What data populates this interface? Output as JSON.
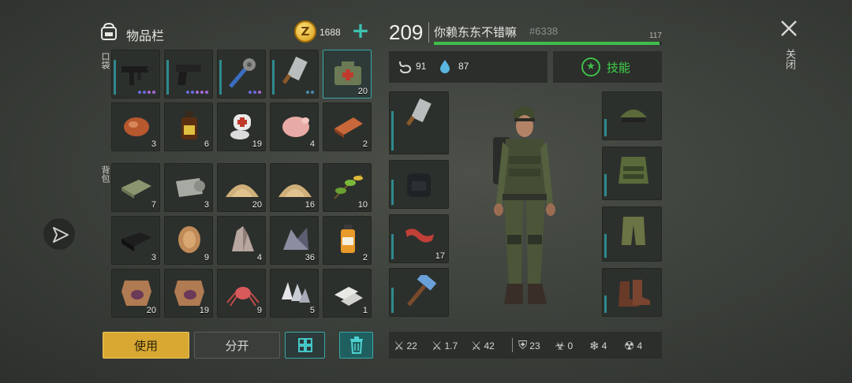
{
  "inventory": {
    "title": "物品栏",
    "coins": "1688",
    "pocket_label": "口袋",
    "backpack_label": "背包",
    "pocket_row1": [
      {
        "icon": "smg-icon",
        "qty": "",
        "dots": [
          "#6a6adf",
          "#6a6adf",
          "#a76ad5",
          "#a76ad5"
        ]
      },
      {
        "icon": "pistol-icon",
        "qty": "",
        "dots": [
          "#6a6adf",
          "#6a6adf",
          "#a76ad5",
          "#a76ad5",
          "#a76ad5"
        ]
      },
      {
        "icon": "spiked-club-icon",
        "qty": "",
        "dots": [
          "#6a6adf",
          "#6a6adf",
          "#a76ad5"
        ]
      },
      {
        "icon": "cleaver-icon",
        "qty": "",
        "dots": [
          "#4a8ab0",
          "#4a8ab0"
        ]
      },
      {
        "icon": "medkit-icon",
        "qty": "20",
        "dots": []
      }
    ],
    "pocket_row2": [
      {
        "icon": "meat-chunk-icon",
        "qty": "3"
      },
      {
        "icon": "bottle-icon",
        "qty": "6"
      },
      {
        "icon": "bandage-icon",
        "qty": "19"
      },
      {
        "icon": "raw-chicken-icon",
        "qty": "4"
      },
      {
        "icon": "copper-ingot-icon",
        "qty": "2"
      }
    ],
    "backpack_row1": [
      {
        "icon": "cloth-icon",
        "qty": "7"
      },
      {
        "icon": "fabric-roll-icon",
        "qty": "3"
      },
      {
        "icon": "sand-pile-icon",
        "qty": "20"
      },
      {
        "icon": "sand-pile-icon",
        "qty": "16"
      },
      {
        "icon": "plant-fiber-icon",
        "qty": "10"
      }
    ],
    "backpack_row2": [
      {
        "icon": "black-leather-icon",
        "qty": "3"
      },
      {
        "icon": "fur-icon",
        "qty": "9"
      },
      {
        "icon": "stone-crystal-icon",
        "qty": "4"
      },
      {
        "icon": "iron-crystal-icon",
        "qty": "36"
      },
      {
        "icon": "oil-bottle-icon",
        "qty": "2"
      }
    ],
    "backpack_row3": [
      {
        "icon": "hide-icon",
        "qty": "20"
      },
      {
        "icon": "hide-icon",
        "qty": "19"
      },
      {
        "icon": "spider-icon",
        "qty": "9"
      },
      {
        "icon": "quartz-icon",
        "qty": "5"
      },
      {
        "icon": "steel-bars-icon",
        "qty": "1"
      }
    ],
    "use_button": "使用",
    "split_button": "分开"
  },
  "character": {
    "level": "209",
    "name": "你赖东东不错嘛",
    "tag": "#6338",
    "xp_value": "117",
    "xp_fraction": 0.99,
    "hunger": "91",
    "thirst": "87",
    "skills_label": "技能",
    "weapon_slots": [
      {
        "icon": "cleaver-icon",
        "qty": ""
      },
      {
        "icon": "backpack-icon",
        "qty": ""
      },
      {
        "icon": "bacon-icon",
        "qty": "17"
      },
      {
        "icon": "hammer-icon",
        "qty": ""
      }
    ],
    "armor_slots": [
      "cap-icon",
      "vest-icon",
      "pants-icon",
      "boots-icon"
    ],
    "stats": [
      {
        "icon": "sword-icon",
        "value": "22"
      },
      {
        "icon": "speed-sword-icon",
        "value": "1.7"
      },
      {
        "icon": "crossed-sword-icon",
        "value": "42"
      },
      {
        "icon": "shield-icon",
        "value": "23"
      },
      {
        "icon": "biohazard-icon",
        "value": "0"
      },
      {
        "icon": "snowflake-icon",
        "value": "4"
      },
      {
        "icon": "radiation-icon",
        "value": "4"
      }
    ]
  },
  "close_label": "关闭",
  "colors": {
    "accent_green": "#3fbf4a",
    "teal": "#2f8a8f",
    "use_gold": "#e4b53d"
  }
}
